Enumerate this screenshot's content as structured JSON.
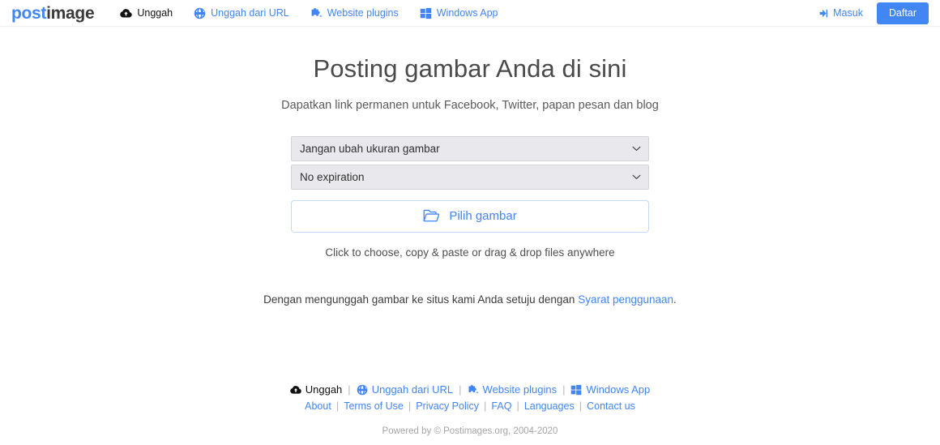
{
  "header": {
    "logo": {
      "part1": "post",
      "part2": "image"
    },
    "nav": [
      {
        "label": "Unggah",
        "icon": "cloud-upload-icon",
        "active": true
      },
      {
        "label": "Unggah dari URL",
        "icon": "globe-icon",
        "active": false
      },
      {
        "label": "Website plugins",
        "icon": "puzzle-piece-icon",
        "active": false
      },
      {
        "label": "Windows App",
        "icon": "windows-logo-icon",
        "active": false
      }
    ],
    "login_label": "Masuk",
    "login_icon": "login-arrow-icon",
    "signup_label": "Daftar"
  },
  "main": {
    "title": "Posting gambar Anda di sini",
    "subtitle": "Dapatkan link permanen untuk Facebook, Twitter, papan pesan dan blog",
    "resize_select": {
      "value": "Jangan ubah ukuran gambar",
      "options": [
        "Jangan ubah ukuran gambar"
      ]
    },
    "expiration_select": {
      "value": "No expiration",
      "options": [
        "No expiration"
      ]
    },
    "choose_button": {
      "label": "Pilih gambar",
      "icon": "open-folder-icon"
    },
    "hint": "Click to choose, copy & paste or drag & drop files anywhere",
    "terms_prefix": "Dengan mengunggah gambar ke situs kami Anda setuju dengan ",
    "terms_link": "Syarat penggunaan",
    "terms_suffix": "."
  },
  "footer": {
    "primary_links": [
      {
        "label": "Unggah",
        "icon": "cloud-upload-icon",
        "active": true
      },
      {
        "label": "Unggah dari URL",
        "icon": "globe-icon",
        "active": false
      },
      {
        "label": "Website plugins",
        "icon": "puzzle-piece-icon",
        "active": false
      },
      {
        "label": "Windows App",
        "icon": "windows-logo-icon",
        "active": false
      }
    ],
    "secondary_links": [
      "About",
      "Terms of Use",
      "Privacy Policy",
      "FAQ",
      "Languages",
      "Contact us"
    ],
    "separator": "|",
    "copyright": "Powered by © Postimages.org, 2004-2020"
  },
  "colors": {
    "accent": "#4285f4",
    "logo_dark": "#3b3b3b",
    "select_bg": "#e9e9ed",
    "muted": "#a5a5a5"
  }
}
